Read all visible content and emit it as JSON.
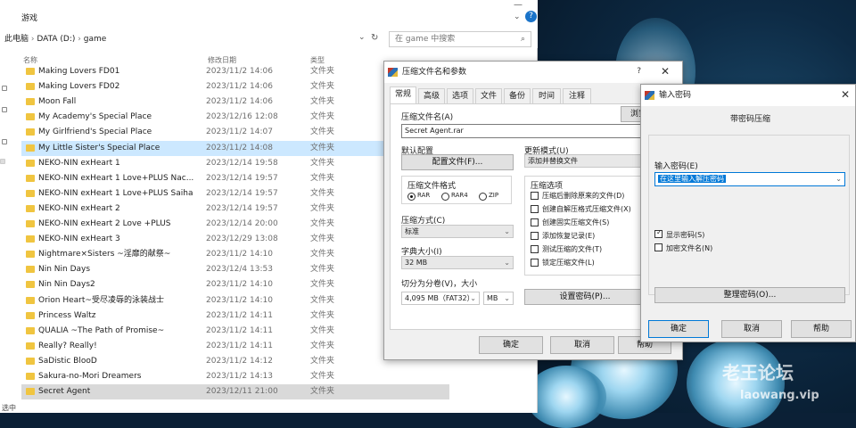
{
  "explorer": {
    "title": "游戏",
    "breadcrumb": [
      "此电脑",
      "DATA (D:)",
      "game"
    ],
    "search_placeholder": "在 game 中搜索",
    "columns": {
      "name": "名称",
      "date": "修改日期",
      "type": "类型"
    },
    "files": [
      {
        "name": "Making Lovers FD01",
        "date": "2023/11/2 14:06",
        "type": "文件夹"
      },
      {
        "name": "Making Lovers FD02",
        "date": "2023/11/2 14:06",
        "type": "文件夹"
      },
      {
        "name": "Moon Fall",
        "date": "2023/11/2 14:06",
        "type": "文件夹"
      },
      {
        "name": "My Academy's Special Place",
        "date": "2023/12/16 12:08",
        "type": "文件夹"
      },
      {
        "name": "My Girlfriend's Special Place",
        "date": "2023/11/2 14:07",
        "type": "文件夹"
      },
      {
        "name": "My Little Sister's Special Place",
        "date": "2023/11/2 14:08",
        "type": "文件夹"
      },
      {
        "name": "NEKO-NIN exHeart 1",
        "date": "2023/12/14 19:58",
        "type": "文件夹"
      },
      {
        "name": "NEKO-NIN exHeart 1 Love+PLUS Nac...",
        "date": "2023/12/14 19:57",
        "type": "文件夹"
      },
      {
        "name": "NEKO-NIN exHeart 1 Love+PLUS Saiha",
        "date": "2023/12/14 19:57",
        "type": "文件夹"
      },
      {
        "name": "NEKO-NIN exHeart 2",
        "date": "2023/12/14 19:57",
        "type": "文件夹"
      },
      {
        "name": "NEKO-NIN exHeart 2 Love +PLUS",
        "date": "2023/12/14 20:00",
        "type": "文件夹"
      },
      {
        "name": "NEKO-NIN exHeart 3",
        "date": "2023/12/29 13:08",
        "type": "文件夹"
      },
      {
        "name": "Nightmare×Sisters ~淫靡的献祭~",
        "date": "2023/11/2 14:10",
        "type": "文件夹"
      },
      {
        "name": "Nin Nin Days",
        "date": "2023/12/4 13:53",
        "type": "文件夹"
      },
      {
        "name": "Nin Nin Days2",
        "date": "2023/11/2 14:10",
        "type": "文件夹"
      },
      {
        "name": "Orion Heart~受尽凌辱的泳装战士",
        "date": "2023/11/2 14:10",
        "type": "文件夹"
      },
      {
        "name": "Princess Waltz",
        "date": "2023/11/2 14:11",
        "type": "文件夹"
      },
      {
        "name": "QUALIA ~The Path of Promise~",
        "date": "2023/11/2 14:11",
        "type": "文件夹"
      },
      {
        "name": "Really? Really!",
        "date": "2023/11/2 14:11",
        "type": "文件夹"
      },
      {
        "name": "SaDistic BlooD",
        "date": "2023/11/2 14:12",
        "type": "文件夹"
      },
      {
        "name": "Sakura-no-Mori Dreamers",
        "date": "2023/11/2 14:13",
        "type": "文件夹"
      },
      {
        "name": "Secret Agent",
        "date": "2023/12/11 21:00",
        "type": "文件夹"
      }
    ],
    "status": "选中"
  },
  "archive_dialog": {
    "title": "压缩文件名和参数",
    "help": "?",
    "tabs": [
      "常规",
      "高级",
      "选项",
      "文件",
      "备份",
      "时间",
      "注释"
    ],
    "archive_name_label": "压缩文件名(A)",
    "browse_label": "浏览",
    "archive_name": "Secret Agent.rar",
    "default_profile_label": "默认配置",
    "profile_button": "配置文件(F)...",
    "update_mode_label": "更新模式(U)",
    "update_mode_value": "添加并替换文件",
    "format_group": "压缩文件格式",
    "formats": [
      "RAR",
      "RAR4",
      "ZIP"
    ],
    "options_group": "压缩选项",
    "options": [
      "压缩后删除原来的文件(D)",
      "创建自解压格式压缩文件(X)",
      "创建固实压缩文件(S)",
      "添加恢复记录(E)",
      "测试压缩的文件(T)",
      "锁定压缩文件(L)"
    ],
    "method_label": "压缩方式(C)",
    "method_value": "标准",
    "dict_label": "字典大小(I)",
    "dict_value": "32 MB",
    "split_label": "切分为分卷(V)，大小",
    "split_value": "4,095 MB（FAT32）",
    "split_unit": "MB",
    "set_password": "设置密码(P)...",
    "ok": "确定",
    "cancel": "取消",
    "help_btn": "帮助"
  },
  "password_dialog": {
    "title": "输入密码",
    "heading": "带密码压缩",
    "input_label": "输入密码(E)",
    "password_value": "在这里输入解压密码",
    "show_password": "显示密码(S)",
    "encrypt_names": "加密文件名(N)",
    "organize": "整理密码(O)...",
    "ok": "确定",
    "cancel": "取消",
    "help": "帮助"
  },
  "watermark": {
    "line1": "老王论坛",
    "line2": "laowang.vip"
  }
}
